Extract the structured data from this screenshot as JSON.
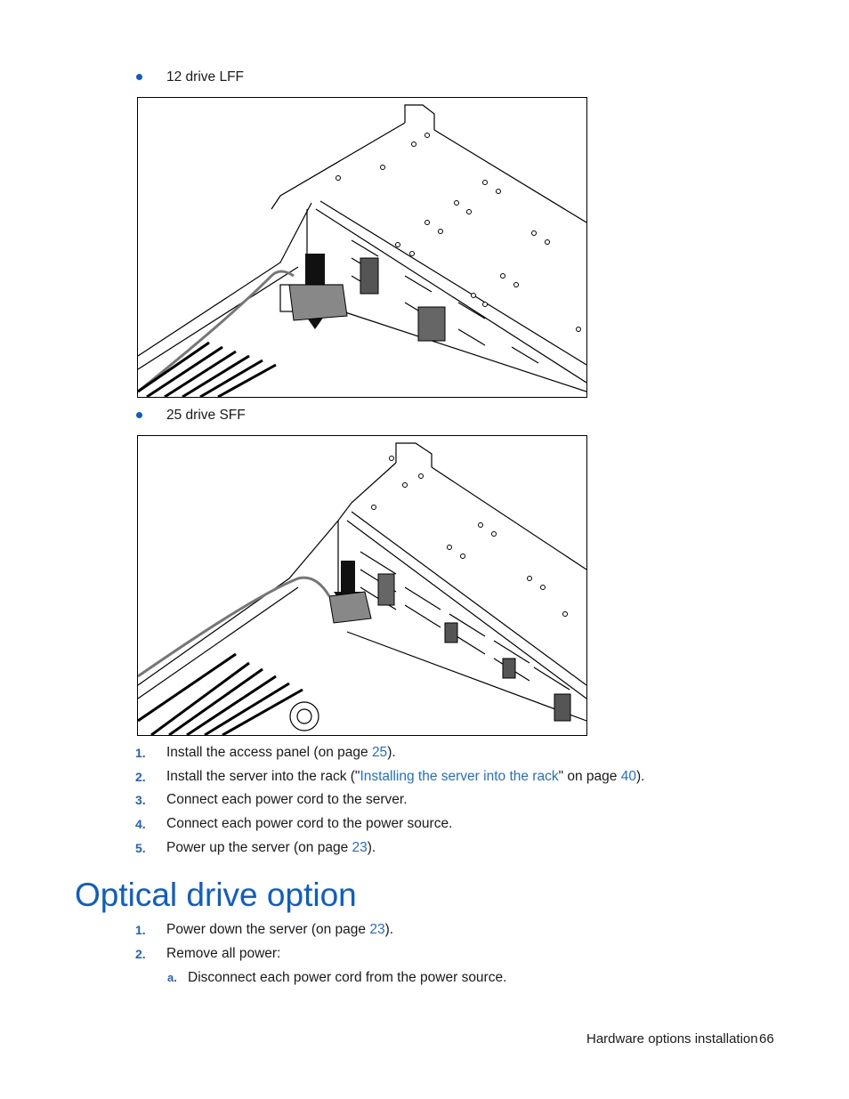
{
  "figures": [
    {
      "bullet": "12 drive LFF",
      "alt": "Server chassis with 12 drive LFF cage, arrow showing cable installation"
    },
    {
      "bullet": "25 drive SFF",
      "alt": "Server chassis with 25 drive SFF cage, arrow showing cable installation"
    }
  ],
  "steps_after_figures": [
    {
      "num": "1.",
      "pre": "Install the access panel (on page ",
      "link": "25",
      "post": ")."
    },
    {
      "num": "2.",
      "pre": "Install the server into the rack (\"",
      "link": "Installing the server into the rack",
      "mid": "\" on page ",
      "link2": "40",
      "post": ")."
    },
    {
      "num": "3.",
      "text": "Connect each power cord to the server."
    },
    {
      "num": "4.",
      "text": "Connect each power cord to the power source."
    },
    {
      "num": "5.",
      "pre": "Power up the server (on page ",
      "link": "23",
      "post": ")."
    }
  ],
  "section": {
    "title": "Optical drive option",
    "steps": [
      {
        "num": "1.",
        "pre": "Power down the server (on page ",
        "link": "23",
        "post": ")."
      },
      {
        "num": "2.",
        "text": "Remove all power:"
      }
    ],
    "substeps": [
      {
        "num": "a.",
        "text": "Disconnect each power cord from the power source."
      }
    ]
  },
  "footer": {
    "section_name": "Hardware options installation",
    "page_number": "66"
  },
  "colors": {
    "accent": "#0a5ecb",
    "link": "#1f6fd6"
  }
}
